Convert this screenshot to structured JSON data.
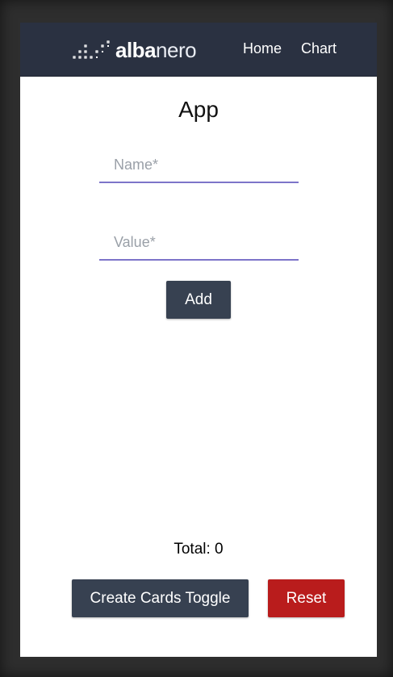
{
  "navbar": {
    "logo": {
      "bold_part": "alba",
      "thin_part": "nero",
      "icon": "dotted-stairs-logo-icon"
    },
    "links": [
      "Home",
      "Chart"
    ]
  },
  "app": {
    "title": "App",
    "name_field": {
      "value": "",
      "placeholder": "Name*"
    },
    "value_field": {
      "value": "",
      "placeholder": "Value*"
    },
    "add_label": "Add",
    "total_label": "Total: 0",
    "toggle_label": "Create Cards Toggle",
    "reset_label": "Reset"
  },
  "colors": {
    "navbar_bg": "#2a3141",
    "primary_button": "#374151",
    "danger_button": "#b91c1c",
    "input_underline": "#7d74c9"
  }
}
